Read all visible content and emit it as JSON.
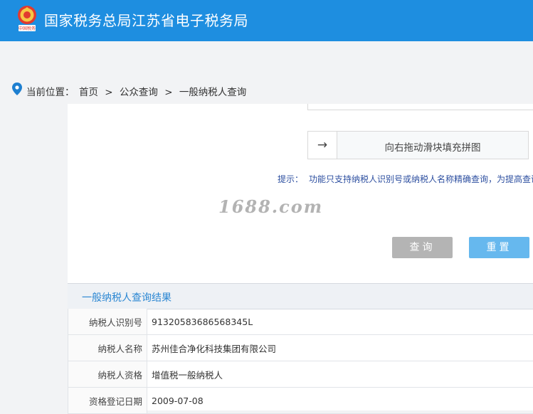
{
  "header": {
    "emblem_text": "中国税务",
    "title": "国家税务总局江苏省电子税务局",
    "bg_color": "#1e8ee0"
  },
  "breadcrumb": {
    "label": "当前位置：",
    "items": [
      "首页",
      "公众查询",
      "一般纳税人查询"
    ],
    "separator": ">"
  },
  "captcha": {
    "handle_icon": "arrow-right-icon",
    "slider_text": "向右拖动滑块填充拼图"
  },
  "tip": {
    "label": "提示：",
    "text": "功能只支持纳税人识别号或纳税人名称精确查询，为提高查询"
  },
  "watermark": "1688.com",
  "buttons": {
    "query": "查询",
    "reset": "重置"
  },
  "result": {
    "title": "一般纳税人查询结果",
    "rows": [
      {
        "key": "纳税人识别号",
        "value": "91320583686568345L"
      },
      {
        "key": "纳税人名称",
        "value": "苏州佳合净化科技集团有限公司"
      },
      {
        "key": "纳税人资格",
        "value": "增值税一般纳税人"
      },
      {
        "key": "资格登记日期",
        "value": "2009-07-08"
      }
    ]
  }
}
